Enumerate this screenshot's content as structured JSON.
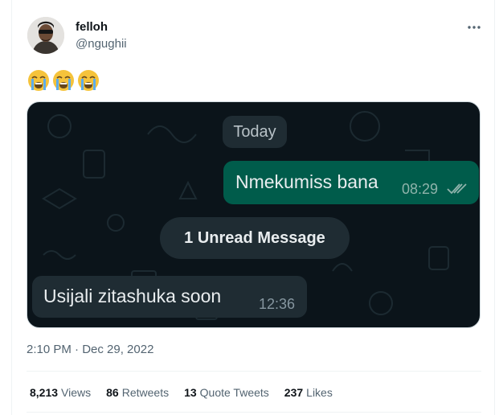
{
  "author": {
    "display_name": "felloh",
    "handle": "@ngughii"
  },
  "tweet": {
    "emojis": [
      "😭",
      "😭",
      "😭"
    ],
    "timestamp": "2:10 PM · Dec 29, 2022"
  },
  "chat_screenshot": {
    "date_label": "Today",
    "unread_label": "1 Unread Message",
    "outgoing": {
      "text": "Nmekumiss bana",
      "time": "08:29",
      "status_icon": "double-check-icon"
    },
    "incoming": {
      "text": "Usijali zitashuka soon",
      "time": "12:36"
    },
    "colors": {
      "background": "#0b141a",
      "outgoing_bubble": "#005c4b",
      "incoming_bubble": "#1f2c33"
    }
  },
  "stats": [
    {
      "value": "8,213",
      "label": "Views"
    },
    {
      "value": "86",
      "label": "Retweets"
    },
    {
      "value": "13",
      "label": "Quote Tweets"
    },
    {
      "value": "237",
      "label": "Likes"
    }
  ],
  "icons": {
    "more": "more-horizontal-icon",
    "avatar": "avatar"
  }
}
